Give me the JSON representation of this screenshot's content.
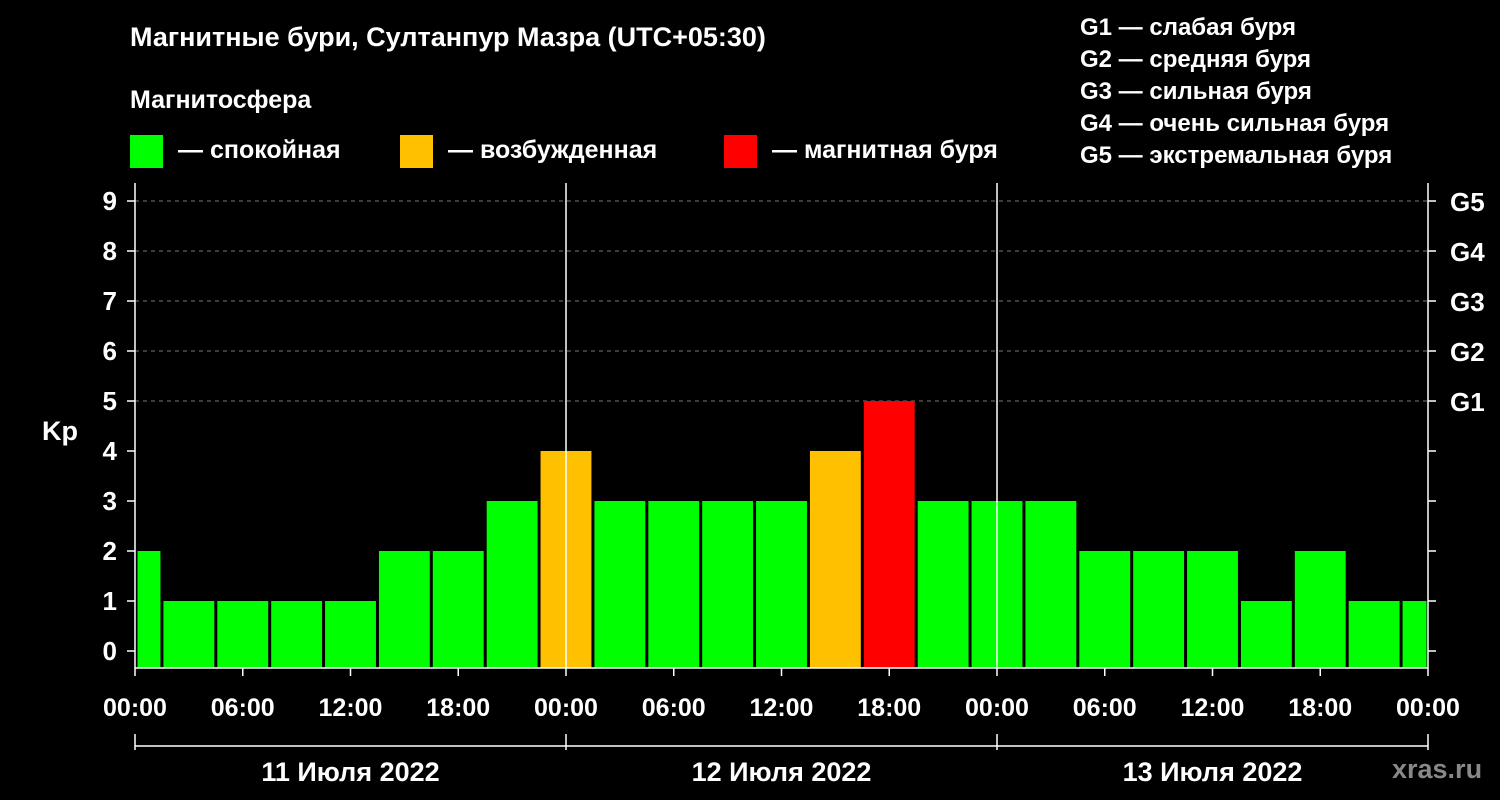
{
  "chart_data": {
    "type": "bar",
    "title": "Магнитные бури, Султанпур Мазра (UTC+05:30)",
    "subtitle": "Магнитосфера",
    "ylabel": "Kp",
    "ylim": [
      0,
      9
    ],
    "y_ticks": [
      "0",
      "1",
      "2",
      "3",
      "4",
      "5",
      "6",
      "7",
      "8",
      "9"
    ],
    "right_ticks": [
      {
        "kp": 5,
        "label": "G1"
      },
      {
        "kp": 6,
        "label": "G2"
      },
      {
        "kp": 7,
        "label": "G3"
      },
      {
        "kp": 8,
        "label": "G4"
      },
      {
        "kp": 9,
        "label": "G5"
      }
    ],
    "x_tick_labels": [
      "00:00",
      "06:00",
      "12:00",
      "18:00",
      "00:00",
      "06:00",
      "12:00",
      "18:00",
      "00:00",
      "06:00",
      "12:00",
      "18:00",
      "00:00"
    ],
    "days": [
      "11 Июля 2022",
      "12 Июля 2022",
      "13 Июля 2022"
    ],
    "x_start_hour": 0,
    "x_end_hour": 72,
    "bar_period_hours": 3,
    "bar_start_hours": [
      -1.5,
      1.5,
      4.5,
      7.5,
      10.5,
      13.5,
      16.5,
      19.5,
      22.5,
      25.5,
      28.5,
      31.5,
      34.5,
      37.5,
      40.5,
      43.5,
      46.5,
      49.5,
      52.5,
      55.5,
      58.5,
      61.5,
      64.5,
      67.5,
      70.5
    ],
    "values": [
      2,
      1,
      1,
      1,
      1,
      2,
      2,
      3,
      4,
      3,
      3,
      3,
      3,
      4,
      5,
      3,
      3,
      3,
      2,
      2,
      2,
      1,
      2,
      1,
      1
    ],
    "levels": [
      "calm",
      "calm",
      "calm",
      "calm",
      "calm",
      "calm",
      "calm",
      "calm",
      "excited",
      "calm",
      "calm",
      "calm",
      "calm",
      "excited",
      "storm",
      "calm",
      "calm",
      "calm",
      "calm",
      "calm",
      "calm",
      "calm",
      "calm",
      "calm",
      "calm"
    ],
    "colors": {
      "calm": "#00ff00",
      "excited": "#ffc000",
      "storm": "#ff0000"
    },
    "grid": true
  },
  "legend": [
    {
      "level": "calm",
      "label": "— спокойная",
      "color": "#00ff00"
    },
    {
      "level": "excited",
      "label": "— возбужденная",
      "color": "#ffc000"
    },
    {
      "level": "storm",
      "label": "— магнитная буря",
      "color": "#ff0000"
    }
  ],
  "g_scale": [
    "G1 — слабая буря",
    "G2 — средняя буря",
    "G3 — сильная буря",
    "G4 — очень сильная буря",
    "G5 — экстремальная буря"
  ],
  "watermark": "xras.ru"
}
